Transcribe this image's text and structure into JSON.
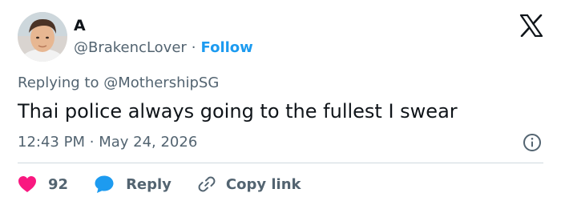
{
  "author": {
    "name": "A",
    "handle": "@BrakencLover",
    "separator": "·",
    "follow_label": "Follow",
    "avatar_icon": "profile-photo"
  },
  "reply_context": {
    "prefix": "Replying to",
    "mention": "@MothershipSG"
  },
  "tweet": {
    "text": "Thai police always going to the fullest I swear",
    "time": "12:43 PM",
    "separator": "·",
    "date": "May 24, 2026"
  },
  "actions": {
    "like_count": "92",
    "reply_label": "Reply",
    "copy_label": "Copy link"
  },
  "icons": {
    "logo": "x-logo-icon",
    "info": "info-icon",
    "heart": "heart-icon",
    "reply": "reply-bubble-icon",
    "link": "link-icon"
  },
  "colors": {
    "accent": "#1d9bf0",
    "heart": "#f91880",
    "text": "#0f1419",
    "muted": "#536471",
    "divider": "#cfd9de"
  }
}
